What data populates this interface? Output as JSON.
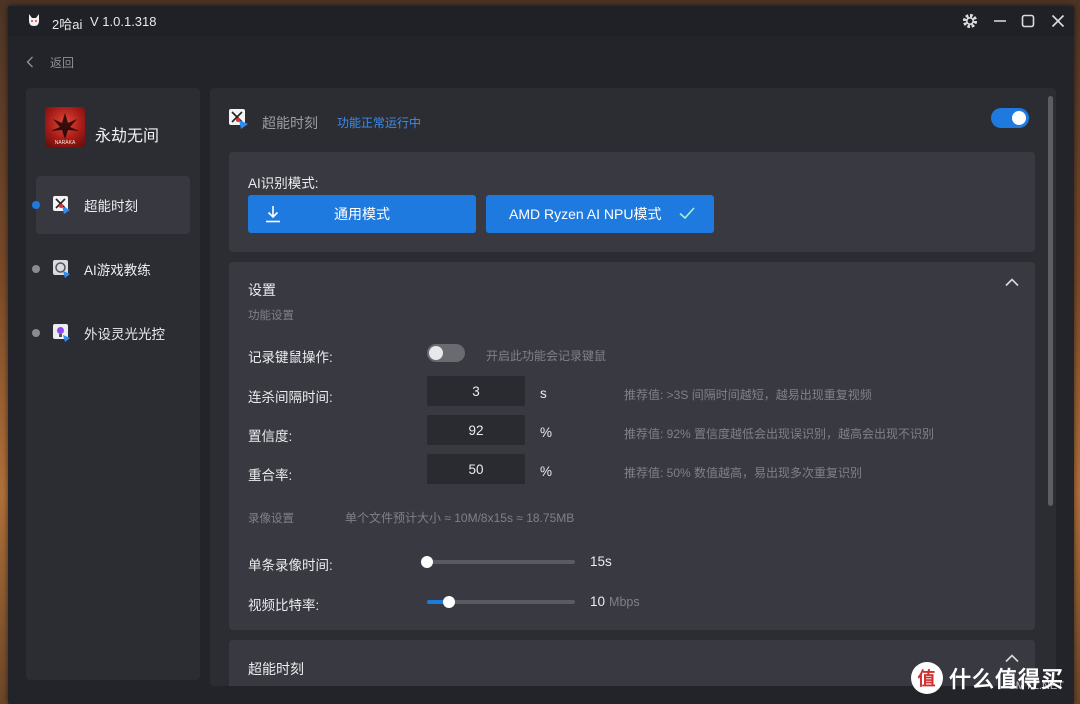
{
  "window": {
    "app_name": "2哈ai",
    "version": "V 1.0.1.318",
    "settings_icon": "gear-icon",
    "minimize_icon": "minimize-icon",
    "maximize_icon": "maximize-icon",
    "close_icon": "close-icon"
  },
  "back": {
    "label": "返回"
  },
  "sidebar": {
    "game_title": "永劫无间",
    "game_logo_text": "NARAKA",
    "items": [
      {
        "label": "超能时刻",
        "active": true,
        "icon": "highlight-moment-icon"
      },
      {
        "label": "AI游戏教练",
        "active": false,
        "icon": "ai-coach-icon"
      },
      {
        "label": "外设灵光光控",
        "active": false,
        "icon": "lighting-control-icon"
      }
    ]
  },
  "header": {
    "title": "超能时刻",
    "status": "功能正常运行中",
    "enabled": true
  },
  "mode": {
    "label": "AI识别模式:",
    "general_label": "通用模式",
    "npu_label": "AMD Ryzen AI NPU模式"
  },
  "settings": {
    "title": "设置",
    "function_section": "功能设置",
    "record_input": {
      "label": "记录键鼠操作:",
      "enabled": false,
      "hint": "开启此功能会记录键鼠"
    },
    "kill_interval": {
      "label": "连杀间隔时间:",
      "value": "3",
      "unit": "s",
      "hint": "推荐值: >3S 间隔时间越短，越易出现重复视频"
    },
    "confidence": {
      "label": "置信度:",
      "value": "92",
      "unit": "%",
      "hint": "推荐值: 92% 置信度越低会出现误识别，越高会出现不识别"
    },
    "overlap": {
      "label": "重合率:",
      "value": "50",
      "unit": "%",
      "hint": "推荐值: 50% 数值越高，易出现多次重复识别"
    },
    "recording_section": "录像设置",
    "file_size_estimate": "单个文件预计大小 ≈ 10M/8x15s ≈ 18.75MB",
    "clip_duration": {
      "label": "单条录像时间:",
      "value_text": "15s",
      "fraction": 0.0
    },
    "bitrate": {
      "label": "视频比特率:",
      "value_text": "10",
      "unit": "Mbps",
      "fraction": 0.15
    }
  },
  "moment_section": {
    "title": "超能时刻"
  },
  "watermark": {
    "text": "什么值得买",
    "sub": "SMYZ.NET",
    "mark": "值"
  },
  "colors": {
    "accent": "#1f7ae0",
    "status": "#3a8cf0",
    "panel": "#393a41",
    "background": "#232429"
  }
}
